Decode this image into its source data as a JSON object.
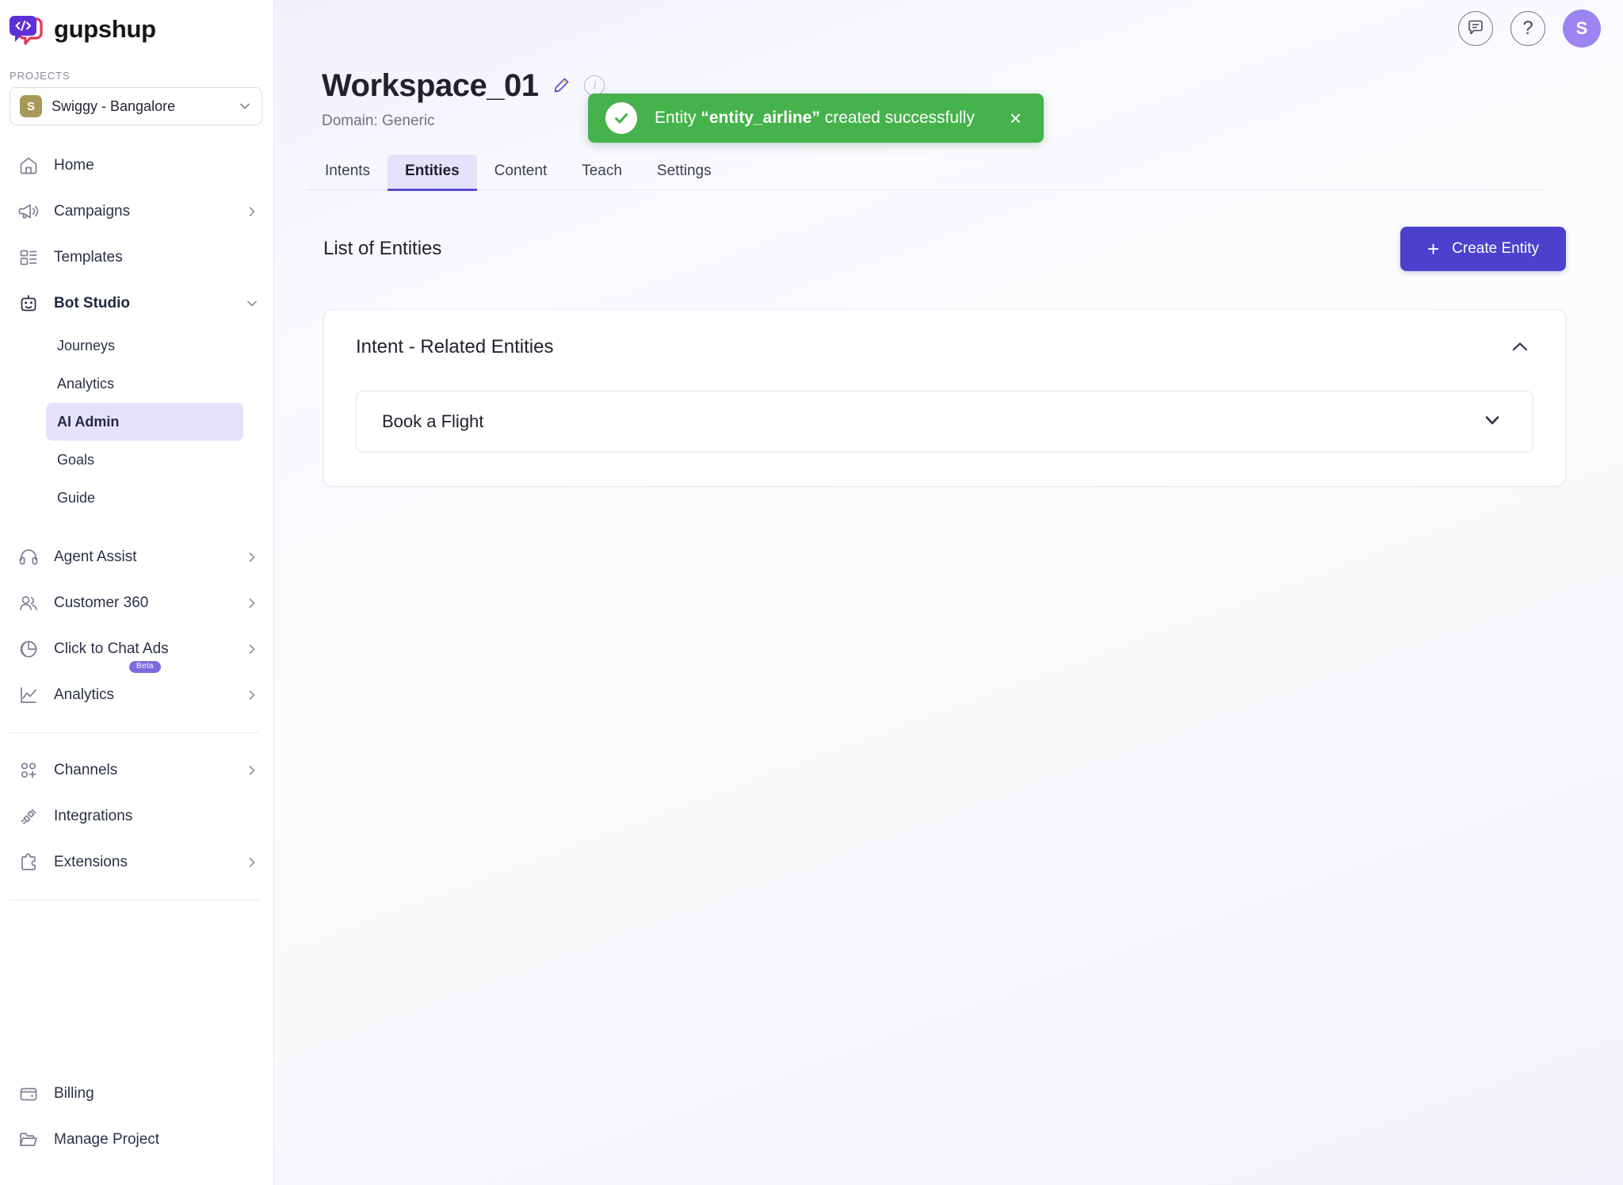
{
  "brand": {
    "name": "gupshup",
    "logo_icon": "gupshup-code-bubble-logo",
    "accent_purple": "#5b4fcf",
    "accent_button": "#4b41cc",
    "toast_green": "#46b24b"
  },
  "sidebar": {
    "projects_label": "PROJECTS",
    "project": {
      "initial": "S",
      "name": "Swiggy - Bangalore",
      "avatar_color": "#a89858",
      "chevron_icon": "chevron-down-icon"
    },
    "nav": [
      {
        "label": "Home",
        "icon": "home-icon",
        "has_chevron": false,
        "expandable": false
      },
      {
        "label": "Campaigns",
        "icon": "megaphone-icon",
        "has_chevron": true,
        "expandable": true
      },
      {
        "label": "Templates",
        "icon": "templates-icon",
        "has_chevron": false,
        "expandable": false
      },
      {
        "label": "Bot Studio",
        "icon": "robot-icon",
        "has_chevron": true,
        "expandable": true,
        "expanded": true,
        "active": true
      }
    ],
    "bot_studio_children": [
      {
        "label": "Journeys",
        "selected": false
      },
      {
        "label": "Analytics",
        "selected": false
      },
      {
        "label": "AI Admin",
        "selected": true
      },
      {
        "label": "Goals",
        "selected": false
      },
      {
        "label": "Guide",
        "selected": false
      }
    ],
    "nav2": [
      {
        "label": "Agent Assist",
        "icon": "headset-icon",
        "has_chevron": true
      },
      {
        "label": "Customer 360",
        "icon": "users-icon",
        "has_chevron": true
      },
      {
        "label": "Click to Chat Ads",
        "icon": "pie-chart-icon",
        "has_chevron": true,
        "badge": "Beta"
      },
      {
        "label": "Analytics",
        "icon": "line-chart-icon",
        "has_chevron": true
      }
    ],
    "nav3": [
      {
        "label": "Channels",
        "icon": "channels-icon",
        "has_chevron": true
      },
      {
        "label": "Integrations",
        "icon": "plug-icon",
        "has_chevron": false
      },
      {
        "label": "Extensions",
        "icon": "puzzle-icon",
        "has_chevron": true
      }
    ],
    "nav_bottom": [
      {
        "label": "Billing",
        "icon": "wallet-icon"
      },
      {
        "label": "Manage Project",
        "icon": "folder-icon"
      }
    ]
  },
  "topbar": {
    "feedback_icon": "chat-bubble-icon",
    "help_icon": "question-mark-icon",
    "help_label": "?",
    "avatar_initial": "S"
  },
  "header": {
    "title": "Workspace_01",
    "edit_icon": "pencil-icon",
    "info_icon": "info-icon",
    "domain_line": "Domain: Generic"
  },
  "tabs": [
    {
      "label": "Intents",
      "active": false
    },
    {
      "label": "Entities",
      "active": true
    },
    {
      "label": "Content",
      "active": false
    },
    {
      "label": "Teach",
      "active": false
    },
    {
      "label": "Settings",
      "active": false
    }
  ],
  "main": {
    "section_title": "List of Entities",
    "create_button": {
      "label": "Create Entity",
      "plus_icon": "plus-icon",
      "plus_glyph": "+"
    },
    "panel": {
      "title": "Intent - Related Entities",
      "collapse_icon": "chevron-up-icon",
      "items": [
        {
          "label": "Book a Flight",
          "expand_icon": "chevron-down-icon"
        }
      ]
    }
  },
  "toast": {
    "icon": "check-circle-icon",
    "prefix": "Entity ",
    "entity_name": "“entity_airline”",
    "suffix": " created successfully",
    "close_icon": "close-icon",
    "close_glyph": "×"
  }
}
